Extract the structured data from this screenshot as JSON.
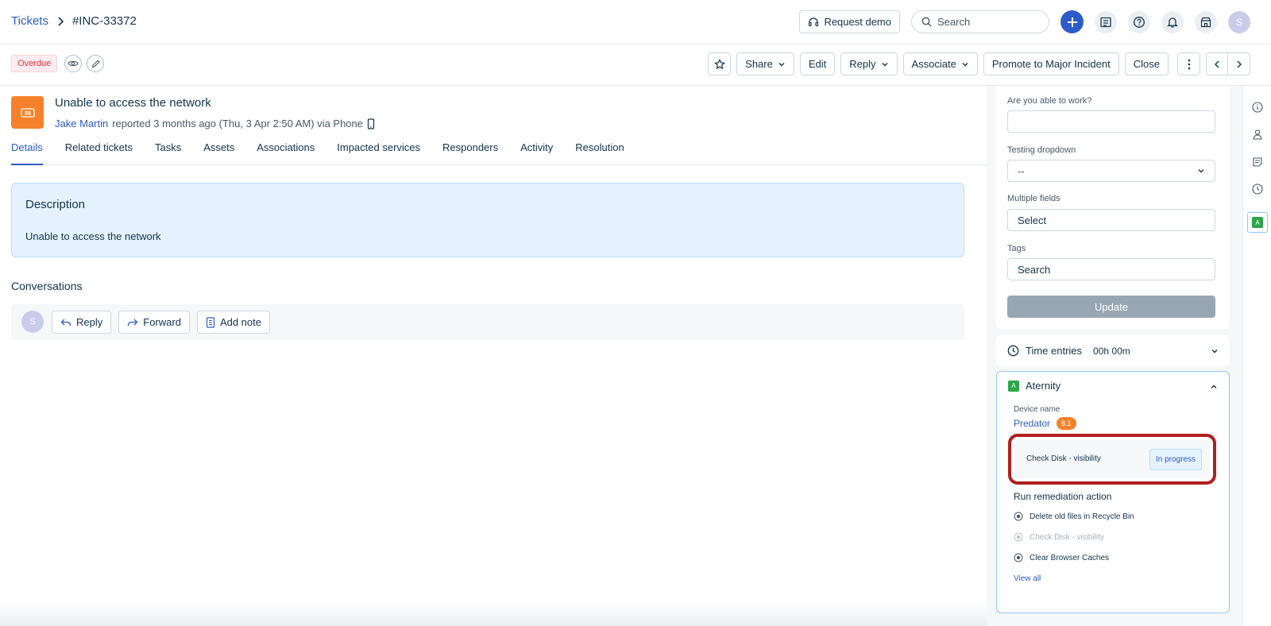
{
  "breadcrumb": {
    "root": "Tickets",
    "ticket_id": "#INC-33372"
  },
  "top": {
    "request_demo": "Request demo",
    "search_placeholder": "Search",
    "avatar_initial": "S"
  },
  "toolbar": {
    "status_badge": "Overdue",
    "share": "Share",
    "edit": "Edit",
    "reply": "Reply",
    "associate": "Associate",
    "promote": "Promote to Major Incident",
    "close": "Close"
  },
  "ticket": {
    "title": "Unable to access the network",
    "requester": "Jake Martin",
    "reported_text": "reported 3 months ago (Thu, 3 Apr 2:50 AM) via Phone"
  },
  "tabs": [
    "Details",
    "Related tickets",
    "Tasks",
    "Assets",
    "Associations",
    "Impacted services",
    "Responders",
    "Activity",
    "Resolution"
  ],
  "description": {
    "title": "Description",
    "body": "Unable to access the network"
  },
  "conversations": {
    "title": "Conversations",
    "avatar_initial": "S",
    "reply": "Reply",
    "forward": "Forward",
    "add_note": "Add note"
  },
  "properties": {
    "able_to_work_label": "Are you able to work?",
    "able_to_work_value": "",
    "testing_dropdown_label": "Testing dropdown",
    "testing_dropdown_value": "--",
    "multiple_fields_label": "Multiple fields",
    "multiple_fields_value": "Select",
    "tags_label": "Tags",
    "tags_placeholder": "Search",
    "update": "Update"
  },
  "time_entries": {
    "label": "Time entries",
    "value": "00h 00m"
  },
  "aternity": {
    "logo_letter": "A",
    "title": "Aternity",
    "device_label": "Device name",
    "device_name": "Predator",
    "score": "8.1",
    "check_label": "Check Disk - visibility",
    "check_status": "In progress",
    "run_title": "Run remediation action",
    "actions": [
      {
        "label": "Delete old files in Recycle Bin",
        "enabled": true
      },
      {
        "label": "Check Disk - visibility",
        "enabled": false
      },
      {
        "label": "Clear Browser Caches",
        "enabled": true
      }
    ],
    "view_all": "View all"
  },
  "colors": {
    "accent": "#2c5cc5",
    "overdue": "#e43538",
    "ticket_icon": "#f5822b",
    "highlight": "#b21f1f",
    "aternity_green": "#2da54a"
  }
}
